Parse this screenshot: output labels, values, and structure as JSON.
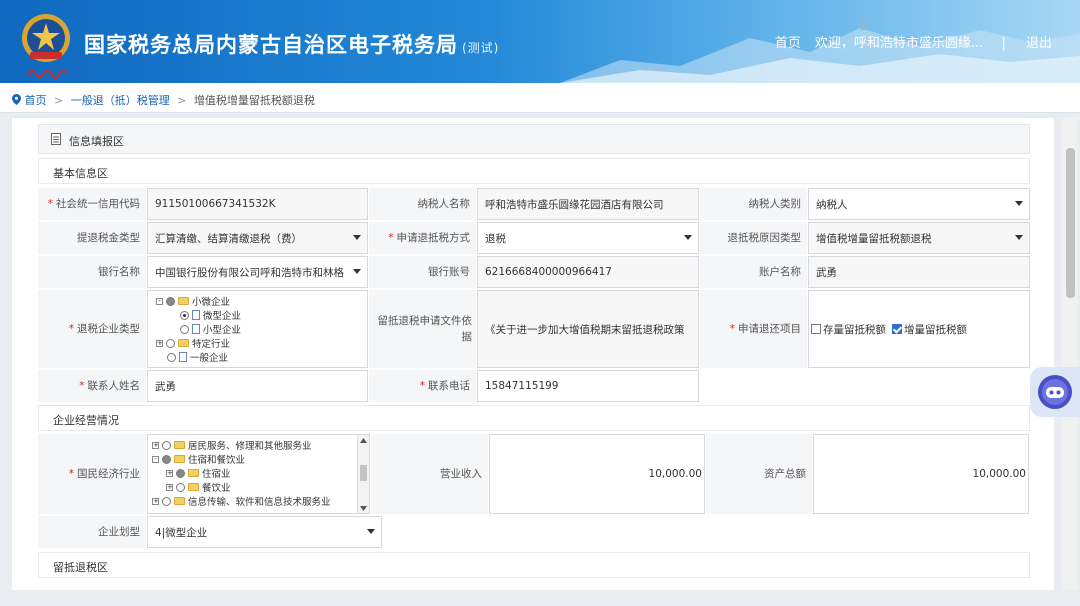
{
  "header": {
    "title": "国家税务总局内蒙古自治区电子税务局",
    "title_suffix": "(测试)",
    "logo_script": "中国税务",
    "nav_home": "首页",
    "nav_welcome": "欢迎，呼和浩特市盛乐圆缘...",
    "nav_divider": "|",
    "nav_logout": "退出"
  },
  "breadcrumb": {
    "home": "首页",
    "sep1": ">",
    "item1": "一般退（抵）税管理",
    "sep2": ">",
    "current": "增值税增量留抵税额退税"
  },
  "panel": {
    "title": "信息填报区"
  },
  "sections": {
    "basic": "基本信息区",
    "business": "企业经营情况",
    "refund": "留抵退税区"
  },
  "form": {
    "credit_code": {
      "label": "社会统一信用代码",
      "value": "91150100667341532K"
    },
    "taxpayer_name": {
      "label": "纳税人名称",
      "value": "呼和浩特市盛乐圆缘花园酒店有限公司"
    },
    "taxpayer_type": {
      "label": "纳税人类别",
      "value": "纳税人"
    },
    "refund_tax_type": {
      "label": "提退税金类型",
      "value": "汇算清缴、结算清缴退税（费）"
    },
    "apply_method": {
      "label": "申请退抵税方式",
      "value": "退税"
    },
    "refund_reason": {
      "label": "退抵税原因类型",
      "value": "增值税增量留抵税额退税"
    },
    "bank_name": {
      "label": "银行名称",
      "value": "中国银行股份有限公司呼和浩特市和林格"
    },
    "bank_account": {
      "label": "银行账号",
      "value": "6216668400000966417"
    },
    "account_name": {
      "label": "账户名称",
      "value": "武勇"
    },
    "enterprise_type": {
      "label": "退税企业类型",
      "tree": [
        "小微企业",
        "微型企业",
        "小型企业",
        "特定行业",
        "一般企业"
      ]
    },
    "basis": {
      "label": "留抵退税申请文件依据",
      "value": "《关于进一步加大增值税期末留抵退税政策"
    },
    "refund_items": {
      "label": "申请退还项目",
      "option1": "存量留抵税额",
      "option2": "增量留抵税额"
    },
    "contact_name": {
      "label": "联系人姓名",
      "value": "武勇"
    },
    "contact_phone": {
      "label": "联系电话",
      "value": "15847115199"
    },
    "industry": {
      "label": "国民经济行业",
      "tree": [
        "居民服务、修理和其他服务业",
        "住宿和餐饮业",
        "住宿业",
        "餐饮业",
        "信息传输、软件和信息技术服务业"
      ]
    },
    "revenue": {
      "label": "营业收入",
      "value": "10,000.00"
    },
    "total_assets": {
      "label": "资产总额",
      "value": "10,000.00"
    },
    "enterprise_class": {
      "label": "企业划型",
      "value": "4|微型企业"
    }
  },
  "colors": {
    "header_blue": "#1a72c9",
    "required": "#e0201a",
    "link": "#1a64b4"
  }
}
